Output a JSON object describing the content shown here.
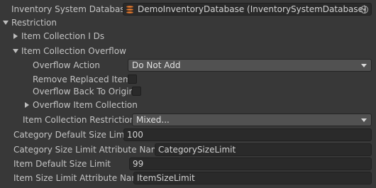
{
  "inspector": {
    "database_label": "Inventory System Database",
    "database_value": "DemoInventoryDatabase (InventorySystemDatabase)",
    "restriction_label": "Restriction",
    "item_collection_ids_label": "Item Collection I Ds",
    "item_collection_overflow_label": "Item Collection Overflow",
    "overflow_action_label": "Overflow Action",
    "overflow_action_value": "Do Not Add",
    "remove_replaced_item_label": "Remove Replaced Item",
    "overflow_back_to_origin_label": "Overflow Back To Origin",
    "overflow_item_collection_label": "Overflow Item Collection",
    "item_collection_restrictions_label": "Item Collection Restrictions",
    "item_collection_restrictions_value": "Mixed...",
    "category_default_size_limit_label": "Category Default Size Limit",
    "category_default_size_limit_value": "100",
    "category_size_limit_attribute_name_label": "Category Size Limit Attribute Name",
    "category_size_limit_attribute_name_value": "CategorySizeLimit",
    "item_default_size_limit_label": "Item Default Size Limit",
    "item_default_size_limit_value": "99",
    "item_size_limit_attribute_name_label": "Item Size Limit Attribute Name",
    "item_size_limit_attribute_name_value": "ItemSizeLimit"
  },
  "checkboxes": {
    "remove_replaced_item": false,
    "overflow_back_to_origin": false
  },
  "icons": {
    "database": "database-icon",
    "object_picker": "object-picker-icon",
    "foldout_collapsed": "triangle-right-icon",
    "foldout_expanded": "triangle-down-icon",
    "dropdown": "chevron-down-icon"
  }
}
